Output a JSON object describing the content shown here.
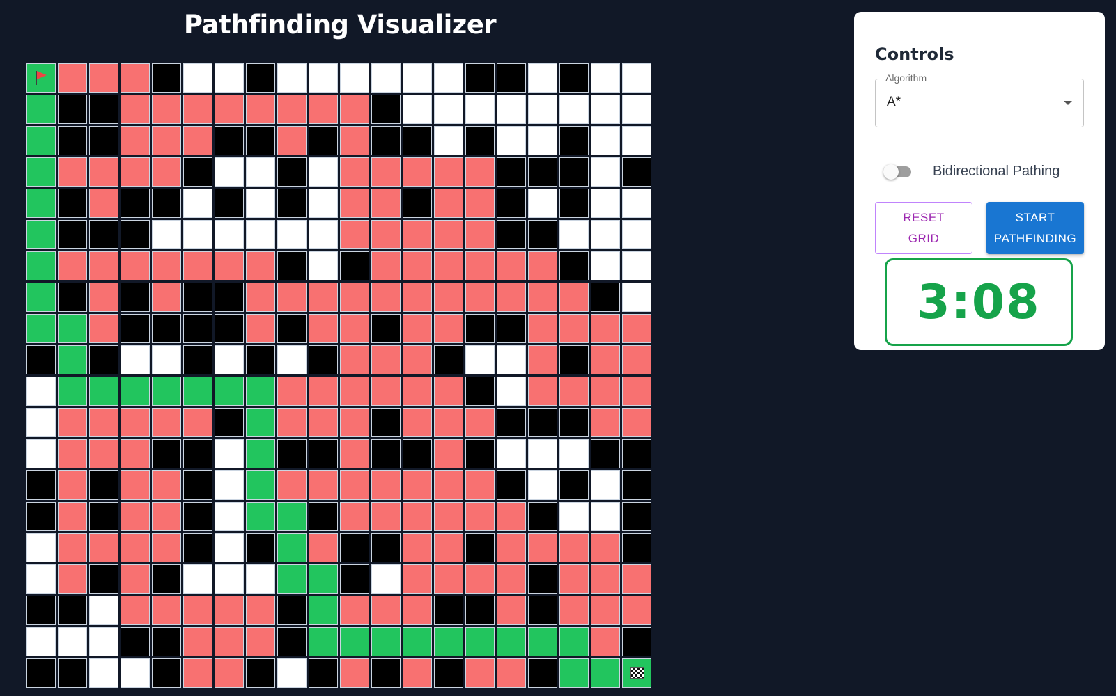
{
  "header": {
    "title": "Pathfinding Visualizer"
  },
  "grid": {
    "rows": 20,
    "cols": 20,
    "legend": {
      "S": "start node (flag-icon)",
      "F": "finish node (checkered-flag-icon)",
      "W": "wall",
      "E": "empty",
      "V": "visited",
      "P": "path"
    },
    "colors": {
      "empty": "#ffffff",
      "wall": "#000000",
      "visited": "#f87171",
      "path": "#22c55e"
    },
    "cells": [
      "SVVVWEEWEEEEEEWWEWEE",
      "PWWVVVVVVVVWEEEEEEEE",
      "PWWVVVWWVWVWWEWEEWEE",
      "PVVVVWEEWEVVVVVWWWEW",
      "PWVWWEWEWEVVWVVWEWEE",
      "PWWWEEEEEEVVVVVWWEEE",
      "PVVVVVVVWEWVVVVVVWEE",
      "PWVWVWWVVVVVVVVVVVWE",
      "PPVWWWWVWVVWVVWWVVVV",
      "WPWEEWEWEWVVVWEEVWVV",
      "EPPPPPPPVVVVVVWEVVVV",
      "EVVVVVWPVVVWVVVWWWVV",
      "EVVVWWEPWWVWWVWEEEWW",
      "WVWVVWEPVVVVVVVWEWEW",
      "WVWVVWEPPWVVVVVVWEEW",
      "EVVVVWEWPVWWVVWVVVVW",
      "EVWVWEEEPPWEVVVVWVVV",
      "WWEVVVVVWPVVVWWVWVVV",
      "EEEWWVVVWPPPPPPPPPVW",
      "WWEEWVVWEWVWVWVVWPPF"
    ]
  },
  "controls": {
    "title": "Controls",
    "algorithm": {
      "label": "Algorithm",
      "value": "A*"
    },
    "bidirectional": {
      "label": "Bidirectional Pathing",
      "enabled": false
    },
    "reset_button": "RESET GRID",
    "start_button": "START PATHFINDING",
    "timer": "3:08",
    "accent_colors": {
      "reset": "#9c27b0",
      "start": "#1976d2",
      "timer": "#16a34a"
    }
  }
}
